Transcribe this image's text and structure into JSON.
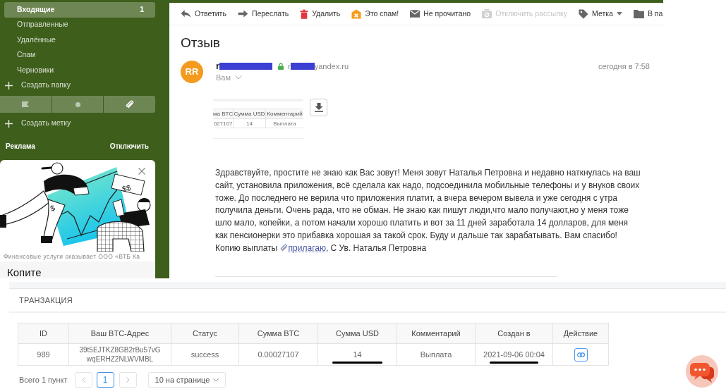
{
  "sidebar": {
    "folders": [
      {
        "label": "Входящие",
        "count": "1",
        "selected": true
      },
      {
        "label": "Отправленные",
        "selected": false
      },
      {
        "label": "Удалённые",
        "selected": false
      },
      {
        "label": "Спам",
        "selected": false
      },
      {
        "label": "Черновики",
        "selected": false
      }
    ],
    "create_folder": "Создать папку",
    "create_label": "Создать метку",
    "ad_label": "Реклама",
    "ad_disable": "Отключить",
    "ad": {
      "illustration_signs": [
        "$$",
        "$"
      ],
      "disclaimer": "Финансовые услуги оказывает ООО «ВТБ Ка",
      "title": "Копите"
    }
  },
  "toolbar": [
    {
      "kind": "reply",
      "label": "Ответить",
      "disabled": false,
      "dropdown": false
    },
    {
      "kind": "forward",
      "label": "Переслать",
      "disabled": false,
      "dropdown": false
    },
    {
      "kind": "delete",
      "label": "Удалить",
      "disabled": false,
      "dropdown": false
    },
    {
      "kind": "spam",
      "label": "Это спам!",
      "disabled": false,
      "dropdown": false
    },
    {
      "kind": "unread",
      "label": "Не прочитано",
      "disabled": false,
      "dropdown": false
    },
    {
      "kind": "unsubscribe",
      "label": "Отключить рассылку",
      "disabled": true,
      "dropdown": false
    },
    {
      "kind": "label",
      "label": "Метка",
      "disabled": false,
      "dropdown": true
    },
    {
      "kind": "move",
      "label": "В па",
      "disabled": false,
      "dropdown": false
    }
  ],
  "message": {
    "subject": "Отзыв",
    "avatar": "RR",
    "sender": "r",
    "email_start": "r",
    "email_end": "yandex.ru",
    "recipient": "Вам",
    "date": "сегодня в 7:58",
    "attachment": {
      "columns": [
        "ма BTC",
        "Сумма USD",
        "Комментарий"
      ],
      "cells": [
        "027107",
        "14",
        "Выплата"
      ]
    },
    "body": "Здравствуйте, простите не знаю как Вас зовут! Меня зовут Наталья Петровна и недавно наткнулась на ваш сайт, установила приложения, всё сделала как надо, подсоединила мобильные телефоны и у внуков своих тоже. До последнего не верила что приложения платит, а вчера вечером вывела и уже сегодня с утра получила деньги. Очень рада, что не обман. Не знаю как пишут люди,что мало получают,но у меня тоже шло мало, копейки, а потом начали хорошо платить и вот за 11 дней заработала 14 долларов, для меня как пенсионерки это прибавка хорошая за такой срок. Буду и дальше так зарабатывать. Вам спасибо! Копию выплаты",
    "link": "прилагаю",
    "closing": ", С Ув. Наталья Петровна"
  },
  "transaction": {
    "title": "ТРАНЗАКЦИЯ",
    "columns": [
      "ID",
      "Ваш BTC-Адрес",
      "Статус",
      "Сумма BTC",
      "Сумма USD",
      "Комментарий",
      "Создан в",
      "Действие"
    ],
    "rows": [
      {
        "cells": [
          {
            "text": "989",
            "marked": false
          },
          {
            "text": "39t5EJTKZ8GB2rBu57vGwqERHZ2NLWVMBL",
            "marked": false
          },
          {
            "text": "success",
            "marked": false
          },
          {
            "text": "0.00027107",
            "marked": false
          },
          {
            "text": "14",
            "marked": true
          },
          {
            "text": "Выплата",
            "marked": false
          },
          {
            "text": "2021-09-06 00:04",
            "marked": true
          }
        ]
      }
    ],
    "pagination": {
      "total": "Всего 1 пункт",
      "pages": [
        {
          "label": "1",
          "selected": true
        }
      ],
      "page_size": "10 на странице"
    }
  }
}
